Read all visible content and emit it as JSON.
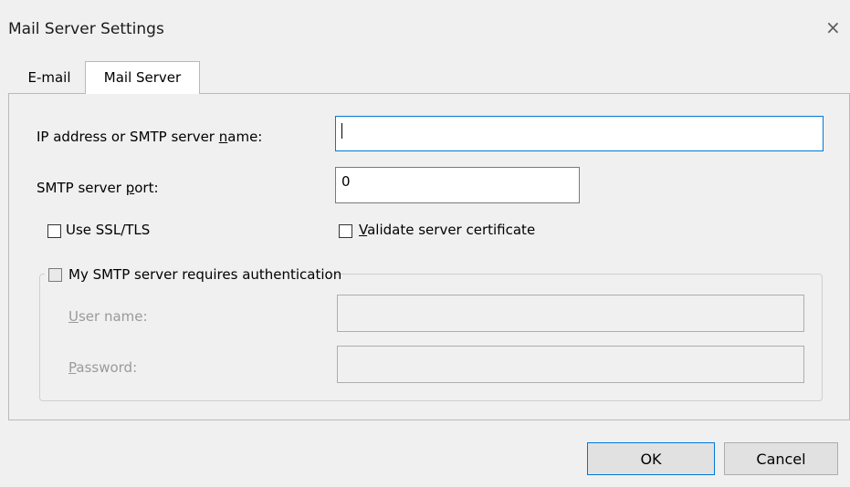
{
  "window": {
    "title": "Mail Server Settings",
    "close_glyph": "×"
  },
  "tabs": [
    {
      "label": "E-mail",
      "active": false
    },
    {
      "label": "Mail Server",
      "active": true
    }
  ],
  "form": {
    "server_name": {
      "label_pre": "IP address or SMTP server ",
      "label_u": "n",
      "label_post": "ame:",
      "value": ""
    },
    "port": {
      "label_pre": "SMTP server ",
      "label_u": "p",
      "label_post": "ort:",
      "value": "0"
    },
    "ssl": {
      "label": "Use SSL/TLS",
      "checked": false
    },
    "validate_cert": {
      "label_u": "V",
      "label_post": "alidate server certificate",
      "checked": false
    }
  },
  "auth_group": {
    "legend": "My SMTP server requires authentication",
    "checked": false,
    "user_name": {
      "label_u": "U",
      "label_post": "ser name:",
      "value": ""
    },
    "password": {
      "label_u": "P",
      "label_post": "assword:",
      "value": ""
    }
  },
  "buttons": {
    "ok": "OK",
    "cancel": "Cancel"
  },
  "colors": {
    "window_bg": "#f0f0f0",
    "focus_border": "#0078d7",
    "disabled_text": "#9a9a9a"
  }
}
